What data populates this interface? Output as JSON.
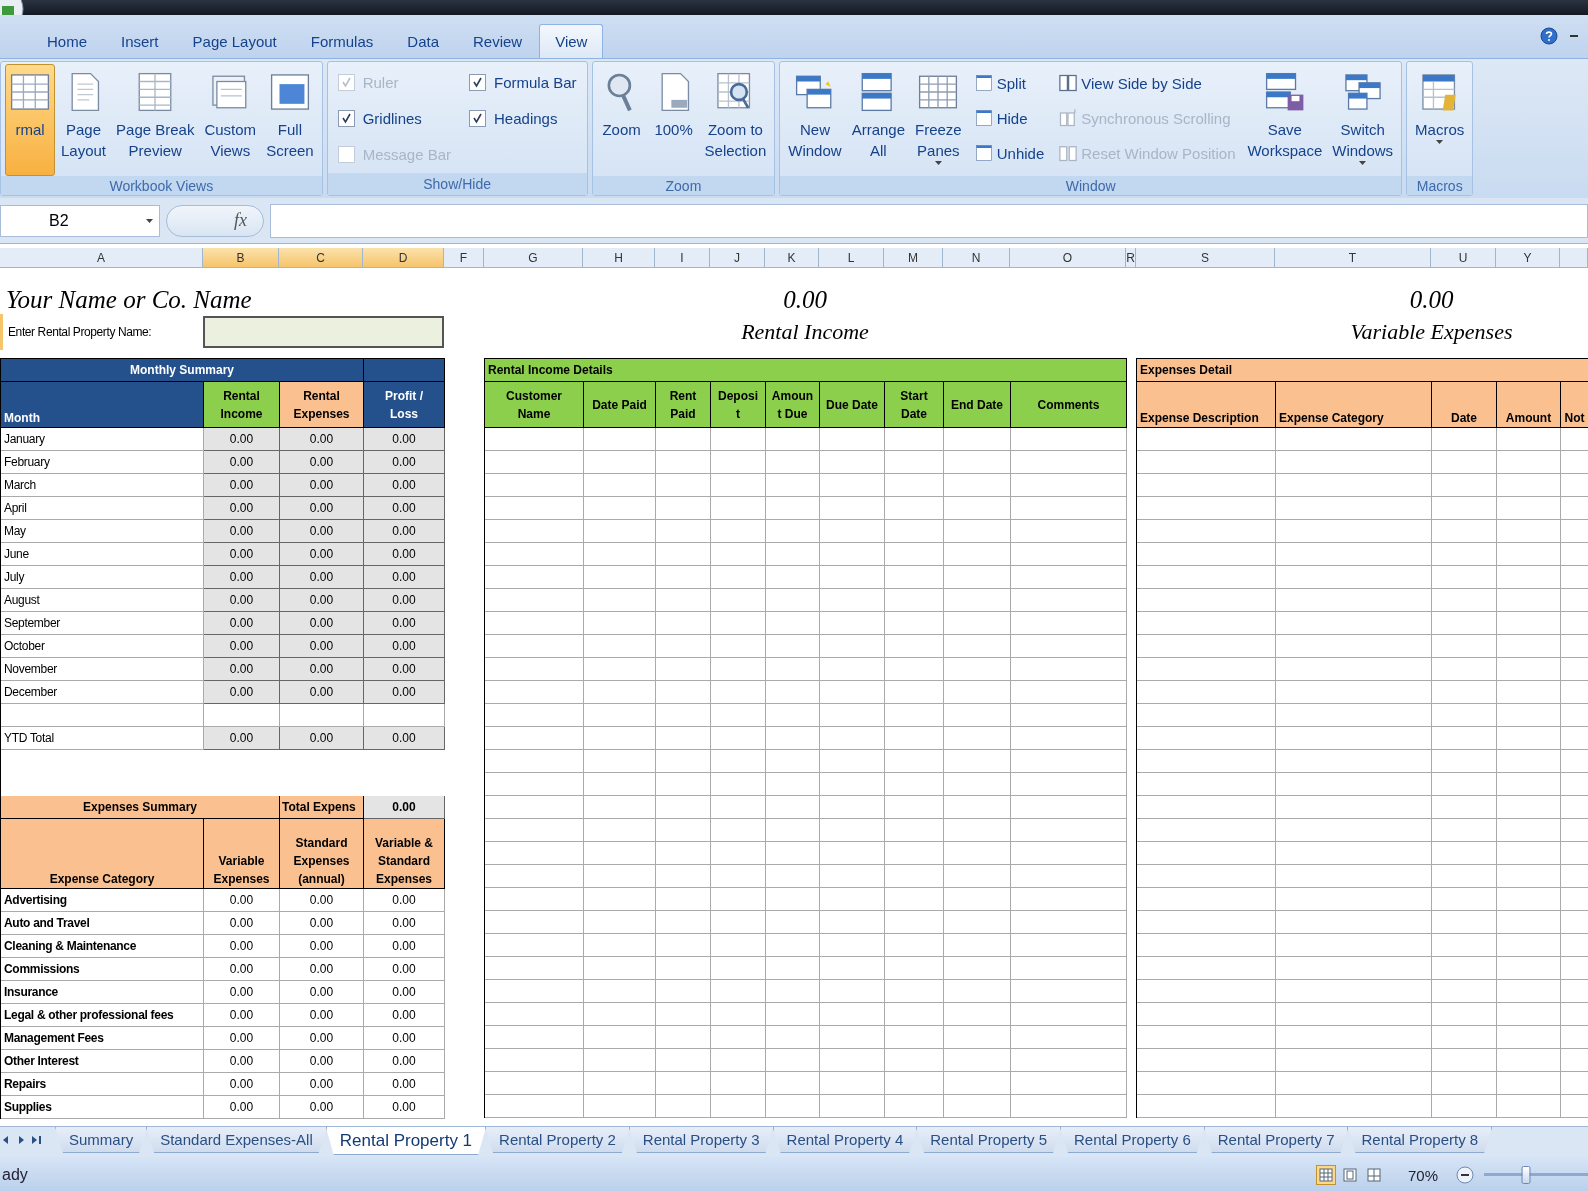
{
  "app_menu": {
    "kind": "orb"
  },
  "ribbon": {
    "tabs": [
      {
        "label": "Home",
        "selected": false
      },
      {
        "label": "Insert",
        "selected": false
      },
      {
        "label": "Page Layout",
        "selected": false
      },
      {
        "label": "Formulas",
        "selected": false
      },
      {
        "label": "Data",
        "selected": false
      },
      {
        "label": "Review",
        "selected": false
      },
      {
        "label": "View",
        "selected": true
      }
    ],
    "groups": [
      {
        "label": "Workbook Views",
        "items": [
          {
            "kind": "large",
            "label": "rmal",
            "selected": true
          },
          {
            "kind": "large",
            "label": "Page\nLayout",
            "selected": false
          },
          {
            "kind": "large",
            "label": "Page Break\nPreview",
            "selected": false
          },
          {
            "kind": "large",
            "label": "Custom\nViews",
            "selected": false
          },
          {
            "kind": "large",
            "label": "Full\nScreen",
            "selected": false
          }
        ]
      },
      {
        "label": "Show/Hide",
        "items": [
          {
            "kind": "check",
            "label": "Ruler",
            "checked": true,
            "disabled": true
          },
          {
            "kind": "check",
            "label": "Gridlines",
            "checked": true,
            "disabled": false
          },
          {
            "kind": "check",
            "label": "Message Bar",
            "checked": false,
            "disabled": true
          },
          {
            "kind": "check",
            "label": "Formula Bar",
            "checked": true,
            "disabled": false
          },
          {
            "kind": "check",
            "label": "Headings",
            "checked": true,
            "disabled": false
          }
        ]
      },
      {
        "label": "Zoom",
        "items": [
          {
            "kind": "large",
            "label": "Zoom"
          },
          {
            "kind": "large",
            "label": "100%"
          },
          {
            "kind": "large",
            "label": "Zoom to\nSelection"
          }
        ]
      },
      {
        "label": "Window",
        "items": [
          {
            "kind": "large",
            "label": "New\nWindow"
          },
          {
            "kind": "large",
            "label": "Arrange\nAll"
          },
          {
            "kind": "large",
            "label": "Freeze\nPanes",
            "dropdown": true
          },
          {
            "kind": "stack",
            "items": [
              {
                "label": "Split",
                "disabled": false
              },
              {
                "label": "Hide",
                "disabled": false
              },
              {
                "label": "Unhide",
                "disabled": false
              }
            ]
          },
          {
            "kind": "stack",
            "items": [
              {
                "label": "View Side by Side",
                "disabled": false
              },
              {
                "label": "Synchronous Scrolling",
                "disabled": true
              },
              {
                "label": "Reset Window Position",
                "disabled": true
              }
            ]
          },
          {
            "kind": "large",
            "label": "Save\nWorkspace"
          },
          {
            "kind": "large",
            "label": "Switch\nWindows",
            "dropdown": true
          }
        ]
      },
      {
        "label": "Macros",
        "items": [
          {
            "kind": "large",
            "label": "Macros\n",
            "dropdown": true
          }
        ]
      }
    ]
  },
  "formula_bar": {
    "name_box": "B2",
    "function_label": "fx"
  },
  "sheet": {
    "column_headers": [
      {
        "label": "A",
        "selected": false
      },
      {
        "label": "B",
        "selected": true
      },
      {
        "label": "C",
        "selected": true
      },
      {
        "label": "D",
        "selected": true
      },
      {
        "label": "F",
        "selected": false
      },
      {
        "label": "G",
        "selected": false
      },
      {
        "label": "H",
        "selected": false
      },
      {
        "label": "I",
        "selected": false
      },
      {
        "label": "J",
        "selected": false
      },
      {
        "label": "K",
        "selected": false
      },
      {
        "label": "L",
        "selected": false
      },
      {
        "label": "M",
        "selected": false
      },
      {
        "label": "N",
        "selected": false
      },
      {
        "label": "O",
        "selected": false
      },
      {
        "label": "R",
        "selected": false
      },
      {
        "label": "S",
        "selected": false
      },
      {
        "label": "T",
        "selected": false
      },
      {
        "label": "U",
        "selected": false
      },
      {
        "label": "Y",
        "selected": false
      }
    ],
    "title": "Your Name or Co. Name",
    "property_label": "Enter Rental Property Name:",
    "income_total": "0.00",
    "income_label": "Rental Income",
    "expense_total": "0.00",
    "expense_label": "Variable Expenses",
    "monthly_summary": {
      "title": "Monthly Summary",
      "columns": [
        "Month",
        "Rental\nIncome",
        "Rental\nExpenses",
        "Profit /\nLoss"
      ],
      "rows": [
        [
          "January",
          "0.00",
          "0.00",
          "0.00"
        ],
        [
          "February",
          "0.00",
          "0.00",
          "0.00"
        ],
        [
          "March",
          "0.00",
          "0.00",
          "0.00"
        ],
        [
          "April",
          "0.00",
          "0.00",
          "0.00"
        ],
        [
          "May",
          "0.00",
          "0.00",
          "0.00"
        ],
        [
          "June",
          "0.00",
          "0.00",
          "0.00"
        ],
        [
          "July",
          "0.00",
          "0.00",
          "0.00"
        ],
        [
          "August",
          "0.00",
          "0.00",
          "0.00"
        ],
        [
          "September",
          "0.00",
          "0.00",
          "0.00"
        ],
        [
          "October",
          "0.00",
          "0.00",
          "0.00"
        ],
        [
          "November",
          "0.00",
          "0.00",
          "0.00"
        ],
        [
          "December",
          "0.00",
          "0.00",
          "0.00"
        ]
      ],
      "total": [
        "YTD Total",
        "0.00",
        "0.00",
        "0.00"
      ]
    },
    "expenses_summary": {
      "title": "Expenses Summary",
      "total_label": "Total Expens",
      "total": "0.00",
      "columns": [
        "Expense Category",
        "Variable\nExpenses",
        "Standard\nExpenses\n(annual)",
        "Variable &\nStandard\nExpenses"
      ],
      "rows": [
        [
          "Advertising",
          "0.00",
          "0.00",
          "0.00"
        ],
        [
          "Auto and Travel",
          "0.00",
          "0.00",
          "0.00"
        ],
        [
          "Cleaning & Maintenance",
          "0.00",
          "0.00",
          "0.00"
        ],
        [
          "Commissions",
          "0.00",
          "0.00",
          "0.00"
        ],
        [
          "Insurance",
          "0.00",
          "0.00",
          "0.00"
        ],
        [
          "Legal & other professional fees",
          "0.00",
          "0.00",
          "0.00"
        ],
        [
          "Management Fees",
          "0.00",
          "0.00",
          "0.00"
        ],
        [
          "Other Interest",
          "0.00",
          "0.00",
          "0.00"
        ],
        [
          "Repairs",
          "0.00",
          "0.00",
          "0.00"
        ],
        [
          "Supplies",
          "0.00",
          "0.00",
          "0.00"
        ]
      ]
    },
    "income_details": {
      "title": "Rental Income Details",
      "columns": [
        "Customer\nName",
        "Date Paid",
        "Rent\nPaid",
        "Deposi\nt",
        "Amoun\nt Due",
        "Due Date",
        "Start\nDate",
        "End Date",
        "Comments"
      ]
    },
    "expenses_detail": {
      "title": "Expenses Detail",
      "columns": [
        "Expense Description",
        "Expense Category",
        "Date",
        "Amount",
        "Not"
      ]
    }
  },
  "sheet_tabs": [
    {
      "label": "Summary",
      "selected": false
    },
    {
      "label": "Standard Expenses-All",
      "selected": false
    },
    {
      "label": "Rental Property 1",
      "selected": true
    },
    {
      "label": "Rental Property 2",
      "selected": false
    },
    {
      "label": "Rental Property 3",
      "selected": false
    },
    {
      "label": "Rental Property 4",
      "selected": false
    },
    {
      "label": "Rental Property 5",
      "selected": false
    },
    {
      "label": "Rental Property 6",
      "selected": false
    },
    {
      "label": "Rental Property 7",
      "selected": false
    },
    {
      "label": "Rental Property 8",
      "selected": false
    }
  ],
  "status_bar": {
    "status": "ady",
    "views": [
      {
        "selected": true
      },
      {
        "selected": false
      },
      {
        "selected": false
      }
    ],
    "zoom": "70%",
    "zoom_slider": {
      "level": 0.4
    }
  }
}
